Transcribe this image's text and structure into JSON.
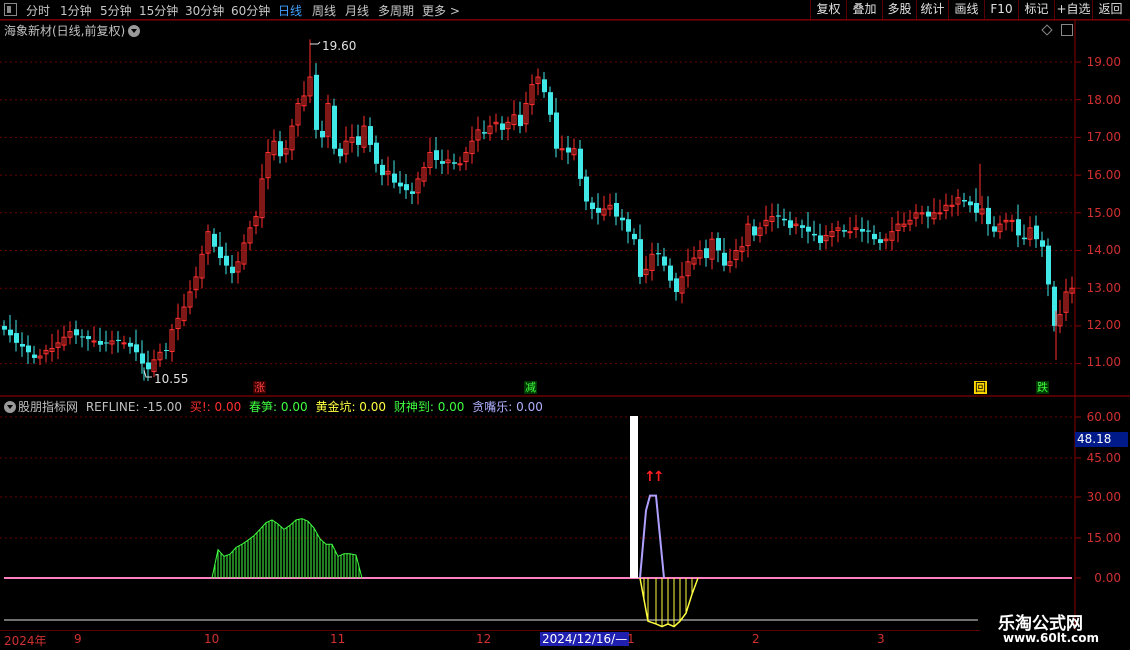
{
  "toolbar": {
    "periods": [
      "分时",
      "1分钟",
      "5分钟",
      "15分钟",
      "30分钟",
      "60分钟",
      "日线",
      "周线",
      "月线",
      "多周期",
      "更多 >"
    ],
    "active_period": "日线",
    "right_buttons": [
      "复权",
      "叠加",
      "多股",
      "统计",
      "画线",
      "F10",
      "标记",
      "+自选",
      "返回"
    ]
  },
  "main_panel": {
    "title": "海象新材(日线,前复权)",
    "price_labels": [
      "19.00",
      "18.00",
      "17.00",
      "16.00",
      "15.00",
      "14.00",
      "13.00",
      "12.00",
      "11.00"
    ],
    "high_annotation": "19.60",
    "low_annotation": "10.55",
    "markers": [
      {
        "text": "涨",
        "color": "#ff4040"
      },
      {
        "text": "减",
        "color": "#40ff40"
      },
      {
        "text": "回",
        "color": "#ffd700"
      },
      {
        "text": "跌",
        "color": "#40ff40"
      }
    ],
    "colors": {
      "up": "#ff3030",
      "down": "#40e8e8",
      "grid": "#700000"
    }
  },
  "indicator_panel": {
    "name": "股朋指标网",
    "fields": [
      {
        "label": "REFLINE: -15.00",
        "color": "#c0c0c0"
      },
      {
        "label": "买!: 0.00",
        "color": "#ff3030"
      },
      {
        "label": "春笋: 0.00",
        "color": "#40ff40"
      },
      {
        "label": "黄金坑: 0.00",
        "color": "#ffff40"
      },
      {
        "label": "财神到: 0.00",
        "color": "#40ff40"
      },
      {
        "label": "贪嘴乐: 0.00",
        "color": "#b0b0ff"
      }
    ],
    "axis_labels": [
      "60.00",
      "45.00",
      "30.00",
      "15.00",
      "0.00"
    ],
    "current_value": "48.18",
    "signal_arrows": "↑↑"
  },
  "x_axis": {
    "labels": [
      "2024年",
      "9",
      "10",
      "11",
      "12",
      "1",
      "2",
      "3"
    ],
    "cursor_date": "2024/12/16/—"
  },
  "watermark": {
    "line1": "乐淘公式网",
    "line2": "www.60lt.com"
  }
}
